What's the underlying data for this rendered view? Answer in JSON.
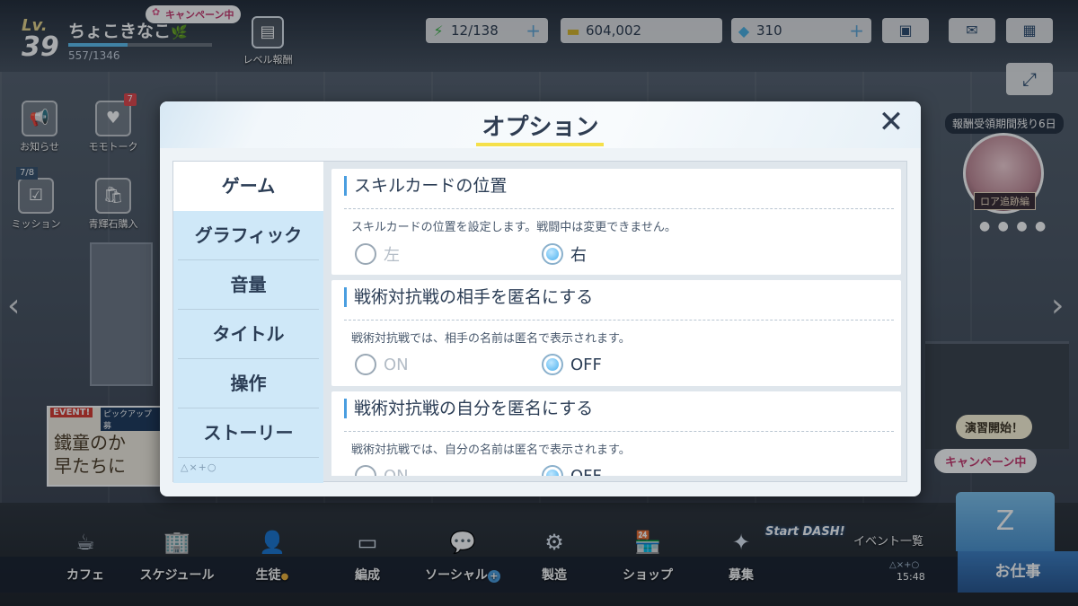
{
  "hud": {
    "level_label": "Lv.",
    "level": "39",
    "player_name": "ちょこきなこ",
    "exp_text": "557/1346",
    "exp_fraction": 0.414,
    "campaign_tag": "キャンペーン中",
    "reward_button": "レベル報酬",
    "ap": "12/138",
    "credits": "604,002",
    "gems": "310"
  },
  "left_quick": {
    "notice": "お知らせ",
    "momotalk": "モモトーク",
    "momotalk_badge": "7",
    "mission": "ミッション",
    "mission_counter": "7/8",
    "gem_shop": "青輝石購入"
  },
  "event_banner": {
    "tag_event": "EVENT!",
    "tag_pickup": "ピックアップ募",
    "text_line1": "鐵童のか",
    "text_line2": "早たちに"
  },
  "right_panel": {
    "reward_period": "報酬受領期間残り6日",
    "char_tag": "ロア追跡編",
    "drill_button": "演習開始！",
    "campaign_button": "キャンペーン中",
    "event_list": "イベント一覧",
    "work_button": "お仕事",
    "clock": "15:48",
    "symbols": "△×+○"
  },
  "bottom_nav": [
    {
      "label": "カフェ"
    },
    {
      "label": "スケジュール"
    },
    {
      "label": "生徒"
    },
    {
      "label": "編成"
    },
    {
      "label": "ソーシャル"
    },
    {
      "label": "製造"
    },
    {
      "label": "ショップ"
    },
    {
      "label": "募集"
    }
  ],
  "start_dash": "Start DASH!",
  "dialog": {
    "title": "オプション",
    "tabs": [
      "ゲーム",
      "グラフィック",
      "音量",
      "タイトル",
      "操作",
      "ストーリー"
    ],
    "active_tab": "ゲーム",
    "tab_symbols": "△×+○",
    "settings": [
      {
        "title": "スキルカードの位置",
        "description": "スキルカードの位置を設定します。戦闘中は変更できません。",
        "option_a": "左",
        "option_b": "右",
        "selected": "右"
      },
      {
        "title": "戦術対抗戦の相手を匿名にする",
        "description": "戦術対抗戦では、相手の名前は匿名で表示されます。",
        "option_a": "ON",
        "option_b": "OFF",
        "selected": "OFF"
      },
      {
        "title": "戦術対抗戦の自分を匿名にする",
        "description": "戦術対抗戦では、自分の名前は匿名で表示されます。",
        "option_a": "ON",
        "option_b": "OFF",
        "selected": "OFF"
      }
    ]
  },
  "colors": {
    "accent_blue": "#4a9ee0",
    "title_underline": "#f5e04a",
    "tab_bg": "#cfe8f8"
  }
}
